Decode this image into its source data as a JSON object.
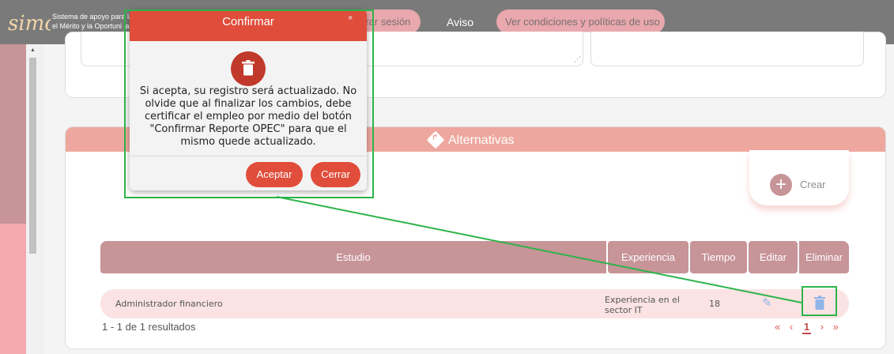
{
  "topbar": {
    "logo_text": "simo",
    "subtitle_line1": "Sistema de apoyo para la",
    "subtitle_line2": "el Mérito y la Oportuni la",
    "logout_label": "rrar sesión",
    "aviso_label": "Aviso",
    "terms_label": "Ver condiciones y políticas de uso"
  },
  "section": {
    "title": "Alternativas",
    "create_label": "Crear"
  },
  "table": {
    "headers": [
      "Estudio",
      "Experiencia",
      "Tiempo",
      "Editar",
      "Eliminar"
    ],
    "rows": [
      {
        "estudio": "Administrador financiero",
        "experiencia": "Experiencia en el sector IT",
        "tiempo": "18"
      }
    ]
  },
  "pagination": {
    "results_text": "1 - 1 de 1 resultados",
    "first": "«",
    "prev": "‹",
    "current": "1",
    "next": "›",
    "last": "»"
  },
  "modal": {
    "title": "Confirmar",
    "close_glyph": "×",
    "message": "Si acepta, su registro será actualizado. No olvide que al finalizar los cambios, debe certificar el empleo por medio del botón \"Confirmar Reporte OPEC\" para que el mismo quede actualizado.",
    "accept_label": "Aceptar",
    "cancel_label": "Cerrar"
  },
  "icons": {
    "modal_icon": "trash-icon",
    "edit": "pencil-icon",
    "delete": "trash-icon",
    "create": "plus-circle-icon",
    "section": "directions-diamond-icon"
  },
  "colors": {
    "accent": "#e04d3a",
    "header_rose": "#c79498",
    "section_salmon": "#eea79e",
    "highlight": "#2cb34a"
  }
}
